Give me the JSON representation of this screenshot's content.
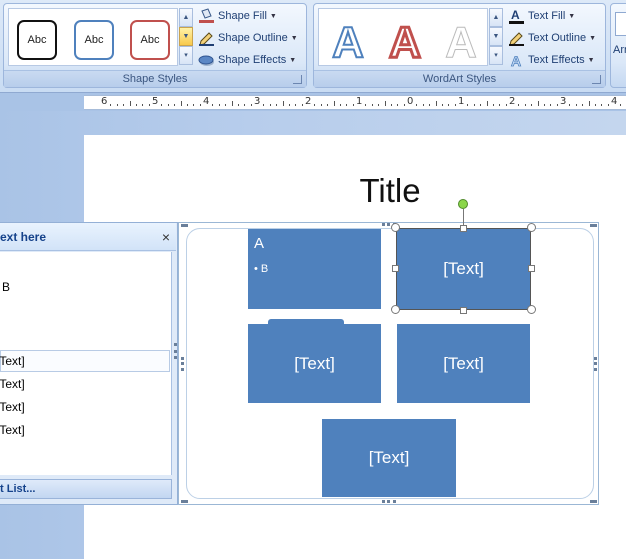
{
  "ribbon": {
    "shape_styles": {
      "label": "Shape Styles",
      "presets": [
        "Abc",
        "Abc",
        "Abc"
      ],
      "fill_label": "Shape Fill",
      "outline_label": "Shape Outline",
      "effects_label": "Shape Effects"
    },
    "wordart_styles": {
      "label": "WordArt Styles",
      "presets": [
        "A",
        "A",
        "A"
      ],
      "fill_label": "Text Fill",
      "outline_label": "Text Outline",
      "effects_label": "Text Effects"
    },
    "arrange_partial": "Arr"
  },
  "ruler": {
    "numbers": [
      "6",
      "5",
      "4",
      "3",
      "2",
      "1",
      "0",
      "1",
      "2",
      "3",
      "4"
    ]
  },
  "slide": {
    "title": "Title",
    "smartart": {
      "first_box": {
        "heading": "A",
        "bullet": "B"
      },
      "boxes": [
        "[Text]",
        "[Text]",
        "[Text]",
        "[Text]"
      ]
    }
  },
  "text_pane": {
    "title": "ext here",
    "close": "×",
    "lines": [
      "B",
      "[Text]",
      "[Text]",
      "[Text]",
      "[Text]"
    ],
    "footer": "t List..."
  },
  "colors": {
    "smartart_fill": "#4f81bd",
    "ribbon_bg": "#dde9f8"
  }
}
